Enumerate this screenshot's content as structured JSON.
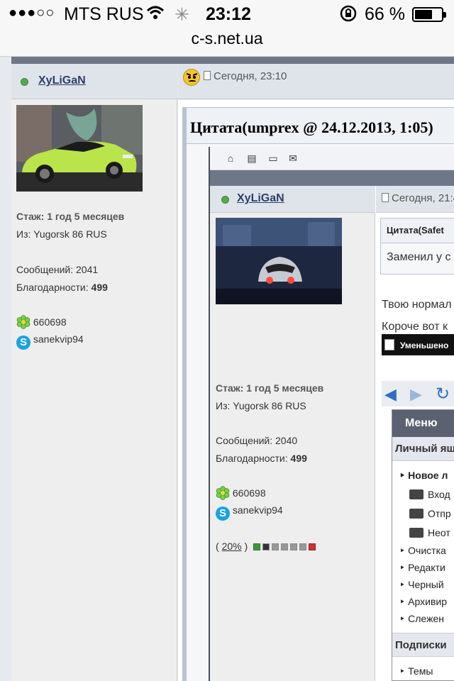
{
  "status_bar": {
    "signal_dots": "●●●○○",
    "carrier": "MTS RUS",
    "time": "23:12",
    "battery_percent": "66 %",
    "battery_level": 0.66
  },
  "url_bar": {
    "domain": "c-s.net.ua"
  },
  "post": {
    "username": "XyLiGaN",
    "timestamp": "Сегодня, 23:10",
    "experience_label": "Стаж: 1 год 5 месяцев",
    "location": "Из: Yugorsk 86 RUS",
    "messages": "Сообщений: 2041",
    "thanks_label": "Благодарности:",
    "thanks_value": "499",
    "icq": "660698",
    "skype": "sanekvip94",
    "quote_title": "Цитата(umprex @ 24.12.2013, 1:05)"
  },
  "nested": {
    "username": "XyLiGaN",
    "timestamp": "Сегодня, 21:4",
    "experience_label": "Стаж: 1 год 5 месяцев",
    "location": "Из: Yugorsk 86 RUS",
    "messages": "Сообщений: 2040",
    "thanks_label": "Благодарности:",
    "thanks_value": "499",
    "icq": "660698",
    "skype": "sanekvip94",
    "rating_prefix": "( ",
    "rating_value": "20%",
    "rating_suffix": " )",
    "quote_title": "Цитата(Safet",
    "quote_text": "Заменил у с",
    "text_line1": "Твою нормал",
    "text_line2": "Короче вот к",
    "reduced_label": "Уменьшено",
    "menu": {
      "title": "Меню",
      "section_personal": "Личный ящ",
      "items": [
        "Новое л",
        "Вход",
        "Отпр",
        "Неот",
        "Очистка",
        "Редакти",
        "Черный",
        "Архивир",
        "Слежен"
      ],
      "section_subs": "Подписки",
      "sub_items": [
        "Темы"
      ]
    }
  }
}
